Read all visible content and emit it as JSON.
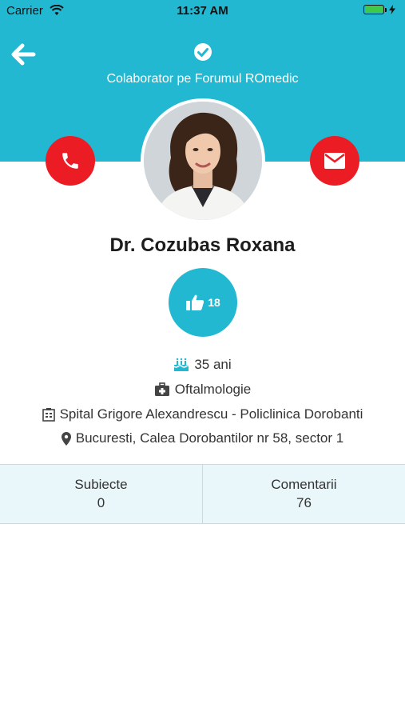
{
  "status_bar": {
    "carrier": "Carrier",
    "time": "11:37 AM",
    "battery_color": "#3ec94a"
  },
  "header": {
    "background_color": "#22b8d1",
    "back_icon": "arrow-left-icon",
    "verified_icon": "check-circle-icon",
    "collaborator_text": "Colaborator pe Forumul ROmedic"
  },
  "actions": {
    "phone_icon": "phone-icon",
    "mail_icon": "envelope-icon",
    "button_color": "#ec1c24"
  },
  "profile": {
    "name": "Dr. Cozubas Roxana",
    "likes": "18",
    "age": "35 ani",
    "specialty": "Oftalmologie",
    "hospital": "Spital Grigore Alexandrescu - Policlinica Dorobanti",
    "address": "Bucuresti, Calea Dorobantilor nr 58, sector 1"
  },
  "stats": [
    {
      "label": "Subiecte",
      "value": "0"
    },
    {
      "label": "Comentarii",
      "value": "76"
    }
  ]
}
